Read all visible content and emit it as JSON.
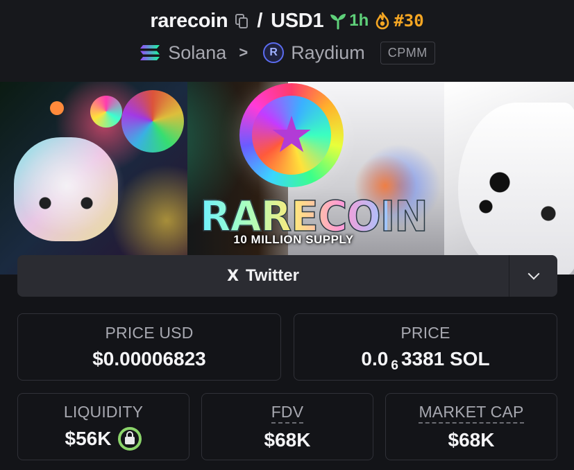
{
  "header": {
    "token_name": "rarecoin",
    "separator": "/",
    "quote_symbol": "USD1",
    "age": "1h",
    "rank": "#30",
    "chain": "Solana",
    "breadcrumb_separator": ">",
    "dex": "Raydium",
    "dex_icon_letter": "R",
    "pool_type": "CPMM"
  },
  "banner": {
    "title": "RARECOIN",
    "subtitle": "10 MILLION SUPPLY",
    "coin_symbol": "★"
  },
  "links": {
    "twitter_icon": "X",
    "twitter_label": "Twitter"
  },
  "stats": {
    "price_usd_label": "PRICE USD",
    "price_usd_value": "$0.00006823",
    "price_label": "PRICE",
    "price_value_prefix": "0.0",
    "price_value_zeros": "6",
    "price_value_suffix": "3381 SOL",
    "liquidity_label": "LIQUIDITY",
    "liquidity_value": "$56K",
    "fdv_label": "FDV",
    "fdv_value": "$68K",
    "market_cap_label": "MARKET CAP",
    "market_cap_value": "$68K"
  },
  "colors": {
    "background": "#131418",
    "age_green": "#5fd17a",
    "rank_orange": "#f5a623",
    "liquidity_lock_green": "#8bd46a",
    "button_bg": "#2b2c32"
  },
  "icons": [
    "copy-icon",
    "seedling-icon",
    "flame-icon",
    "solana-icon",
    "raydium-icon",
    "x-icon",
    "chevron-down-icon",
    "lock-icon"
  ]
}
